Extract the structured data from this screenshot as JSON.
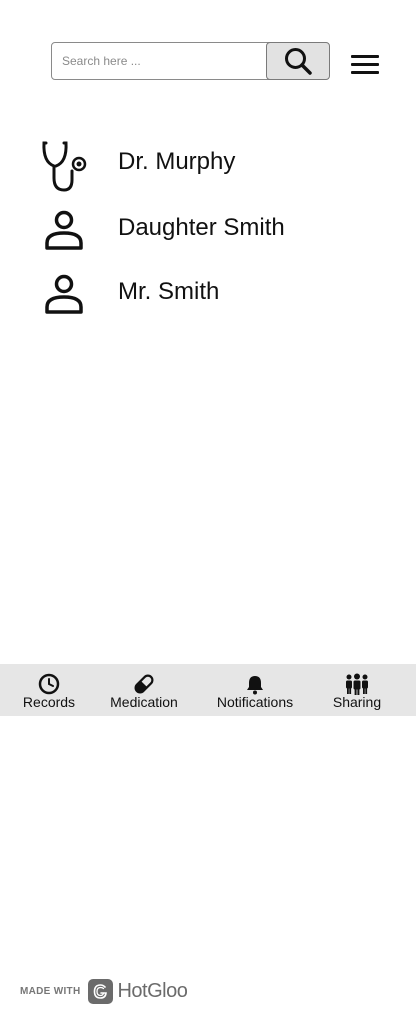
{
  "search": {
    "placeholder": "Search here ..."
  },
  "contacts": [
    {
      "name": "Dr. Murphy",
      "icon": "stethoscope-icon"
    },
    {
      "name": "Daughter Smith",
      "icon": "person-icon"
    },
    {
      "name": "Mr. Smith",
      "icon": "person-icon"
    }
  ],
  "tabs": [
    {
      "label": "Records",
      "icon": "clock-icon"
    },
    {
      "label": "Medication",
      "icon": "pill-icon"
    },
    {
      "label": "Notifications",
      "icon": "bell-icon"
    },
    {
      "label": "Sharing",
      "icon": "group-icon"
    }
  ],
  "footer": {
    "made_with": "MADE WITH",
    "brand": "HotGloo"
  },
  "colors": {
    "tabbar_bg": "#e6e6e6",
    "search_button_bg": "#e2e2e2",
    "text": "#111111"
  }
}
